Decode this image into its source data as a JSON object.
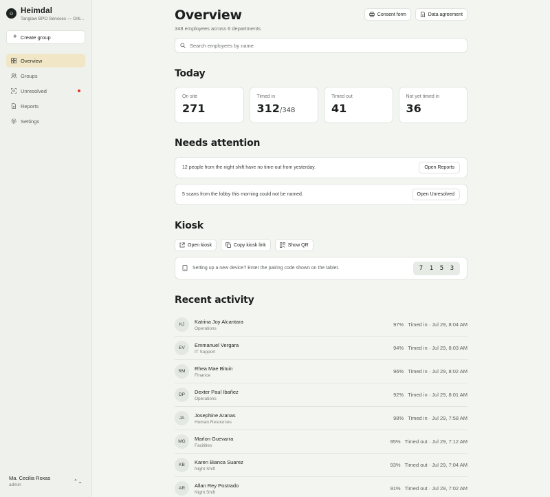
{
  "brand": {
    "name": "Heimdal",
    "subtitle": "Tanglaw BPO Services — Orti..."
  },
  "sidebar": {
    "create_label": "Create group",
    "items": [
      {
        "label": "Overview",
        "icon": "grid-icon",
        "active": true
      },
      {
        "label": "Groups",
        "icon": "users-icon"
      },
      {
        "label": "Unresolved",
        "icon": "scan-face-icon",
        "badge_color": "#e0352b"
      },
      {
        "label": "Reports",
        "icon": "file-icon"
      },
      {
        "label": "Settings",
        "icon": "gear-icon"
      }
    ],
    "user": {
      "name": "Ma. Cecilia Roxas",
      "role": "admin"
    }
  },
  "header": {
    "title": "Overview",
    "subtitle": "348 employees across 6 departments",
    "consent_label": "Consent form",
    "agreement_label": "Data agreement"
  },
  "search": {
    "placeholder": "Search employees by name"
  },
  "today": {
    "heading": "Today",
    "stats": [
      {
        "label": "On site",
        "value": "271"
      },
      {
        "label": "Timed in",
        "value": "312",
        "of": "/348"
      },
      {
        "label": "Timed out",
        "value": "41"
      },
      {
        "label": "Not yet timed in",
        "value": "36"
      }
    ]
  },
  "attention": {
    "heading": "Needs attention",
    "items": [
      {
        "text": "12 people from the night shift have no time-out from yesterday.",
        "action": "Open Reports"
      },
      {
        "text": "5 scans from the lobby this morning could not be named.",
        "action": "Open Unresolved"
      }
    ]
  },
  "kiosk": {
    "heading": "Kiosk",
    "open_label": "Open kiosk",
    "copy_label": "Copy kiosk link",
    "qr_label": "Show QR",
    "pairing_text": "Setting up a new device? Enter the pairing code shown on the tablet.",
    "code": [
      "7",
      "1",
      "5",
      "3"
    ]
  },
  "activity": {
    "heading": "Recent activity",
    "rows": [
      {
        "initials": "KJ",
        "name": "Katrina Joy Alcantara",
        "dept": "Operations",
        "score": "97%",
        "status": "Timed in · Jul 29, 8:04 AM"
      },
      {
        "initials": "EV",
        "name": "Emmanuel Vergara",
        "dept": "IT Support",
        "score": "94%",
        "status": "Timed in · Jul 29, 8:03 AM"
      },
      {
        "initials": "RM",
        "name": "Rhea Mae Bituin",
        "dept": "Finance",
        "score": "96%",
        "status": "Timed in · Jul 29, 8:02 AM"
      },
      {
        "initials": "DP",
        "name": "Dexter Paul Ibañez",
        "dept": "Operations",
        "score": "92%",
        "status": "Timed in · Jul 29, 8:01 AM"
      },
      {
        "initials": "JA",
        "name": "Josephine Aranas",
        "dept": "Human Resources",
        "score": "98%",
        "status": "Timed in · Jul 29, 7:58 AM"
      },
      {
        "initials": "MG",
        "name": "Marlon Guevarra",
        "dept": "Facilities",
        "score": "95%",
        "status": "Timed out · Jul 29, 7:12 AM"
      },
      {
        "initials": "KB",
        "name": "Karen Bianca Suarez",
        "dept": "Night Shift",
        "score": "93%",
        "status": "Timed out · Jul 29, 7:04 AM"
      },
      {
        "initials": "AR",
        "name": "Allan Rey Postrado",
        "dept": "Night Shift",
        "score": "91%",
        "status": "Timed out · Jul 29, 7:02 AM"
      }
    ]
  }
}
